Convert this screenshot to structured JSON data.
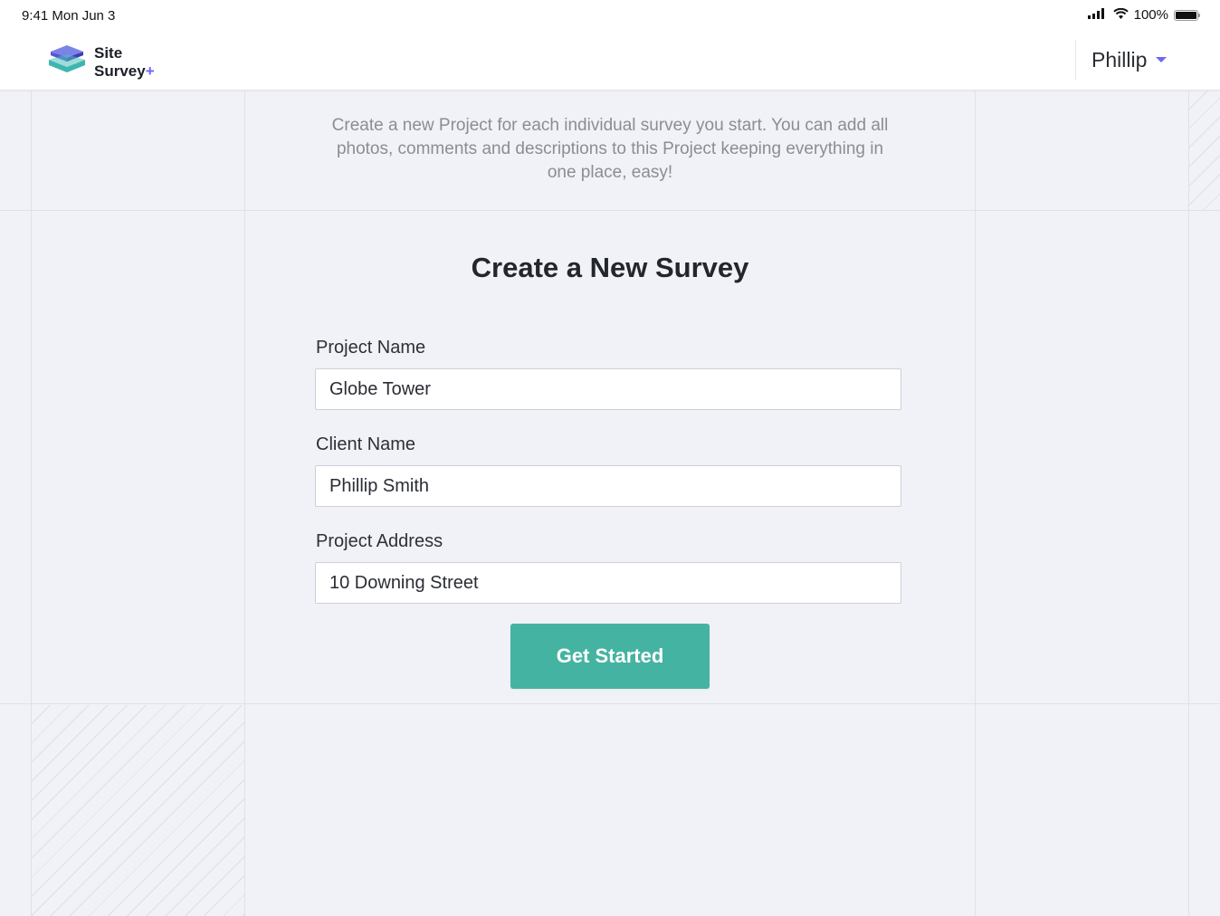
{
  "status_bar": {
    "time_date": "9:41  Mon Jun 3",
    "battery": "100%",
    "battery_level": 1.0
  },
  "header": {
    "logo_line1": "Site",
    "logo_line2": "Survey",
    "logo_plus": "+",
    "user_name": "Phillip",
    "accent_color": "#6c63ff"
  },
  "intro": {
    "text": "Create a new Project for each individual survey you start. You can add all photos, comments and descriptions to this Project keeping everything in one place, easy!"
  },
  "form": {
    "title": "Create a New Survey",
    "fields": [
      {
        "label": "Project Name",
        "value": "Globe Tower"
      },
      {
        "label": "Client Name",
        "value": "Phillip Smith"
      },
      {
        "label": "Project Address",
        "value": "10 Downing Street"
      }
    ],
    "submit_label": "Get Started",
    "submit_color": "#45b3a1"
  }
}
